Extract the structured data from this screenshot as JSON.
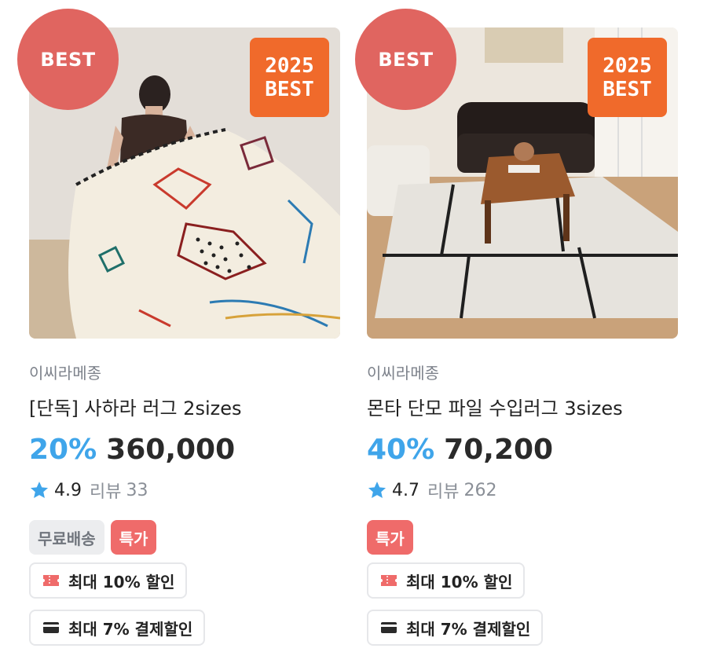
{
  "products": [
    {
      "best_label": "BEST",
      "year_badge": [
        "2025",
        "BEST"
      ],
      "brand": "이씨라메종",
      "title": "[단독] 사하라 러그 2sizes",
      "discount": "20%",
      "price": "360,000",
      "rating": "4.9",
      "review_label": "리뷰",
      "review_count": "33",
      "tags": [
        "무료배송",
        "특가"
      ],
      "coupon_discount": "최대 10% 할인",
      "card_discount": "최대 7% 결제할인"
    },
    {
      "best_label": "BEST",
      "year_badge": [
        "2025",
        "BEST"
      ],
      "brand": "이씨라메종",
      "title": "몬타 단모 파일 수입러그 3sizes",
      "discount": "40%",
      "price": "70,200",
      "rating": "4.7",
      "review_label": "리뷰",
      "review_count": "262",
      "tags": [
        "특가"
      ],
      "coupon_discount": "최대 10% 할인",
      "card_discount": "최대 7% 결제할인"
    }
  ],
  "colors": {
    "best_circle": "#e06560",
    "year_badge": "#f06a2b",
    "discount": "#3fa5ea",
    "star": "#3fa5ea",
    "special_tag": "#ef6b6a",
    "free_shipping_tag": "#ecedef"
  },
  "icons": {
    "star": "star-icon",
    "coupon": "coupon-icon",
    "card": "credit-card-icon"
  }
}
